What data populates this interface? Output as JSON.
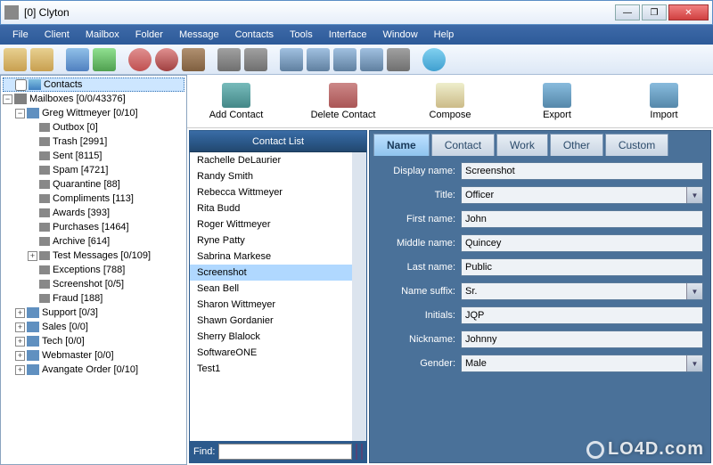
{
  "window": {
    "title": "[0] Clyton"
  },
  "menus": [
    "File",
    "Client",
    "Mailbox",
    "Folder",
    "Message",
    "Contacts",
    "Tools",
    "Interface",
    "Window",
    "Help"
  ],
  "tree": {
    "contacts_label": "Contacts",
    "mailboxes_label": "Mailboxes [0/0/43376]",
    "account": "Greg Wittmeyer [0/10]",
    "folders": [
      "Outbox [0]",
      "Trash [2991]",
      "Sent [8115]",
      "Spam [4721]",
      "Quarantine [88]",
      "Compliments [113]",
      "Awards [393]",
      "Purchases [1464]",
      "Archive [614]",
      "Test Messages [0/109]",
      "Exceptions [788]",
      "Screenshot [0/5]",
      "Fraud [188]"
    ],
    "tail": [
      "Support [0/3]",
      "Sales [0/0]",
      "Tech [0/0]",
      "Webmaster [0/0]",
      "Avangate Order [0/10]"
    ]
  },
  "actions": {
    "add": "Add Contact",
    "delete": "Delete Contact",
    "compose": "Compose",
    "export": "Export",
    "import": "Import"
  },
  "contactlist": {
    "header": "Contact List",
    "items": [
      "Rachelle DeLaurier",
      "Randy Smith",
      "Rebecca Wittmeyer",
      "Rita Budd",
      "Roger Wittmeyer",
      "Ryne Patty",
      "Sabrina Markese",
      "Screenshot",
      "Sean Bell",
      "Sharon Wittmeyer",
      "Shawn Gordanier",
      "Sherry Blalock",
      "SoftwareONE",
      "Test1"
    ],
    "selected": "Screenshot",
    "find_label": "Find:"
  },
  "tabs": {
    "name": "Name",
    "contact": "Contact",
    "work": "Work",
    "other": "Other",
    "custom": "Custom"
  },
  "form": {
    "labels": {
      "display": "Display name:",
      "title": "Title:",
      "first": "First name:",
      "middle": "Middle name:",
      "last": "Last name:",
      "suffix": "Name suffix:",
      "initials": "Initials:",
      "nick": "Nickname:",
      "gender": "Gender:"
    },
    "values": {
      "display": "Screenshot",
      "title": "Officer",
      "first": "John",
      "middle": "Quincey",
      "last": "Public",
      "suffix": "Sr.",
      "initials": "JQP",
      "nick": "Johnny",
      "gender": "Male"
    }
  },
  "watermark": "LO4D.com"
}
